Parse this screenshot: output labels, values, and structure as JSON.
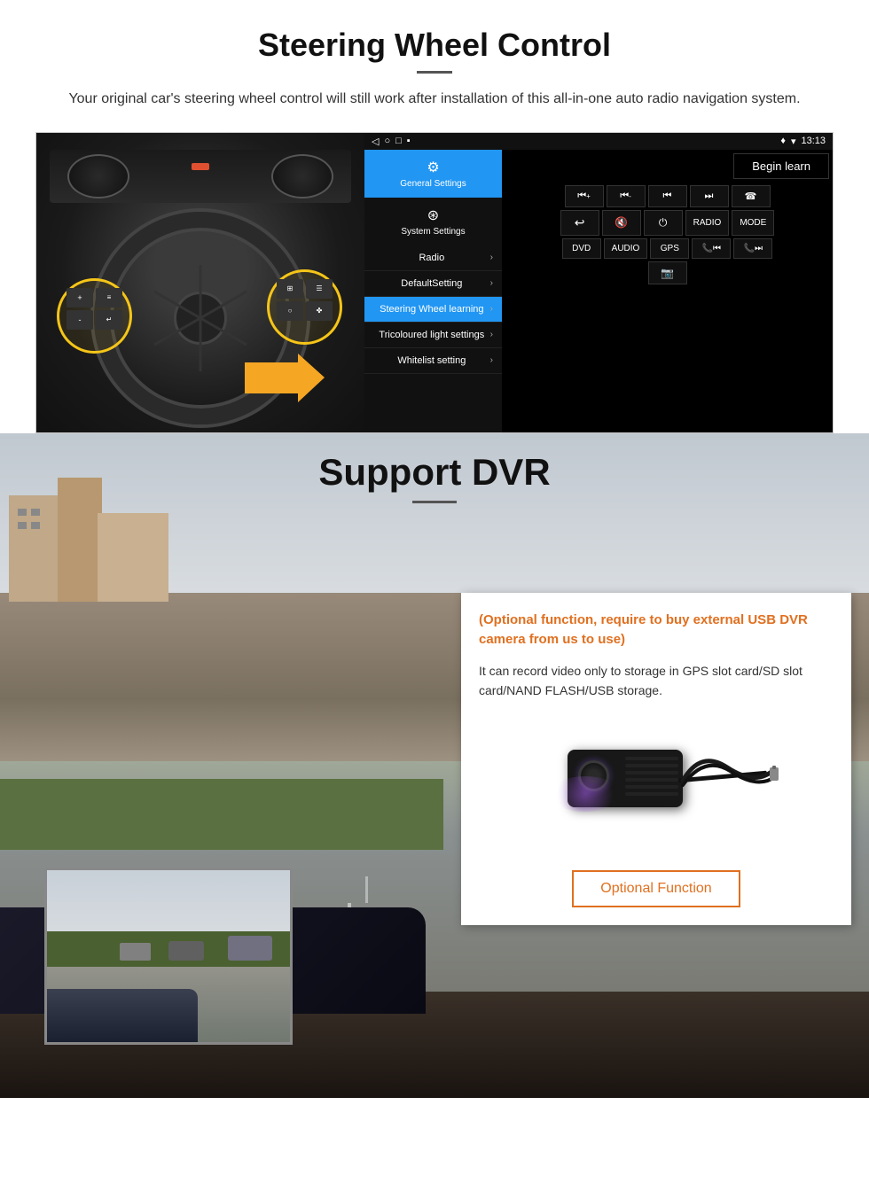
{
  "page": {
    "section1": {
      "title": "Steering Wheel Control",
      "subtitle": "Your original car's steering wheel control will still work after installation of this all-in-one auto radio navigation system.",
      "android": {
        "statusbar": {
          "time": "13:13",
          "icons": "▾ ◂"
        },
        "tabs": [
          {
            "icon": "⚙",
            "label": "General Settings",
            "active": true
          },
          {
            "icon": "☊",
            "label": "System Settings",
            "active": false
          }
        ],
        "menu": [
          {
            "label": "Radio",
            "arrow": "›",
            "active": false
          },
          {
            "label": "DefaultSetting",
            "arrow": "›",
            "active": false
          },
          {
            "label": "Steering Wheel learning",
            "arrow": "›",
            "active": true
          },
          {
            "label": "Tricoloured light settings",
            "arrow": "›",
            "active": false
          },
          {
            "label": "Whitelist setting",
            "arrow": "›",
            "active": false
          }
        ],
        "begin_learn": "Begin learn",
        "controls": [
          [
            "⏮+",
            "⏮-",
            "⏮|",
            "⏭|",
            "☎"
          ],
          [
            "↩",
            "🔇×",
            "⏻",
            "RADIO",
            "MODE"
          ],
          [
            "DVD",
            "AUDIO",
            "GPS",
            "📞⏮|",
            "📞⏭|"
          ],
          [
            "📷"
          ]
        ]
      }
    },
    "section2": {
      "title": "Support DVR",
      "optional_text": "(Optional function, require to buy external USB DVR camera from us to use)",
      "info_text": "It can record video only to storage in GPS slot card/SD slot card/NAND FLASH/USB storage.",
      "optional_function_btn": "Optional Function"
    }
  }
}
